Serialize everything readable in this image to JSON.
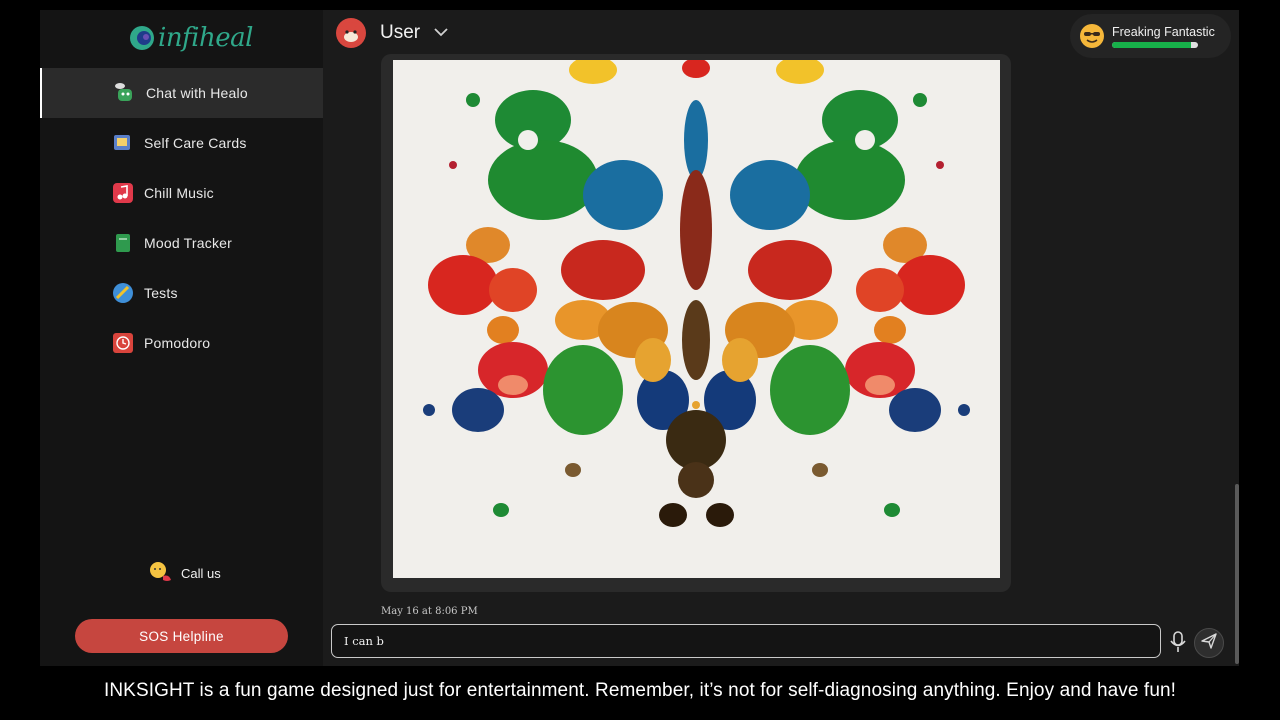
{
  "brand": {
    "logo_text": "infiheal",
    "logo_color": "#2fa88a"
  },
  "sidebar": {
    "items": [
      {
        "label": "Chat with Healo",
        "icon": "chatbot-icon",
        "color": "#3aa35a",
        "active": true
      },
      {
        "label": "Self Care Cards",
        "icon": "cards-icon",
        "color": "#5a7fc9",
        "active": false
      },
      {
        "label": "Chill Music",
        "icon": "music-note-icon",
        "color": "#e0394a",
        "active": false
      },
      {
        "label": "Mood Tracker",
        "icon": "journal-icon",
        "color": "#2f9a4e",
        "active": false
      },
      {
        "label": "Tests",
        "icon": "pencil-check-icon",
        "color": "#3f8fd8",
        "active": false
      },
      {
        "label": "Pomodoro",
        "icon": "timer-icon",
        "color": "#d9443c",
        "active": false
      }
    ],
    "call_us_label": "Call us",
    "sos_label": "SOS Helpline",
    "sos_color": "#c6463f"
  },
  "header": {
    "user_label": "User",
    "mood_label": "Freaking Fantastic",
    "mood_level": 0.92,
    "mood_bar_color": "#17b04a"
  },
  "chat": {
    "message_timestamp": "May 16 at 8:06 PM",
    "image_icon": "inkblot-image"
  },
  "composer": {
    "input_value": "I can b"
  },
  "caption": "INKSIGHT is a fun game designed just for entertainment. Remember, it’s not for self-diagnosing anything. Enjoy and have fun!"
}
